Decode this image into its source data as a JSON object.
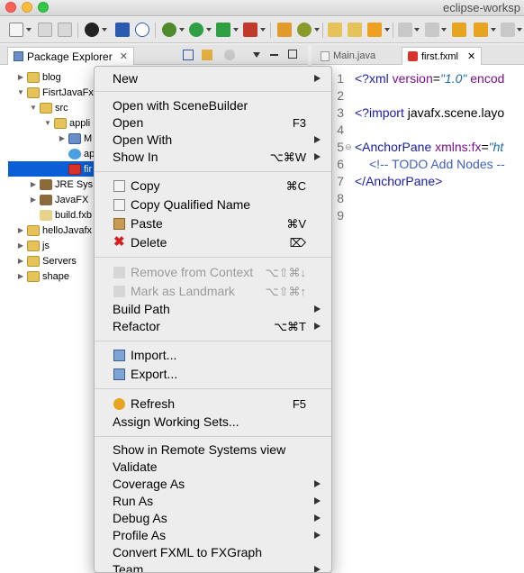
{
  "window": {
    "title": "eclipse-worksp"
  },
  "explorer": {
    "tab_label": "Package Explorer",
    "tree": [
      {
        "label": "blog",
        "icon": "project-icon",
        "twisty": "▶"
      },
      {
        "label": "FisrtJavaFx",
        "icon": "project-icon",
        "twisty": "▼"
      },
      {
        "label": "src",
        "icon": "folder-icon",
        "twisty": "▼"
      },
      {
        "label": "appli",
        "icon": "package-icon",
        "twisty": "▼"
      },
      {
        "label": "M",
        "icon": "java-file-icon",
        "twisty": "▶"
      },
      {
        "label": "ap",
        "icon": "css-file-icon",
        "twisty": ""
      },
      {
        "label": "fir",
        "icon": "fxml-file-icon",
        "twisty": ""
      },
      {
        "label": "JRE Sys",
        "icon": "library-icon",
        "twisty": "▶"
      },
      {
        "label": "JavaFX",
        "icon": "library-icon",
        "twisty": "▶"
      },
      {
        "label": "build.fxb",
        "icon": "file-icon",
        "twisty": ""
      },
      {
        "label": "helloJavafx",
        "icon": "project-icon",
        "twisty": "▶"
      },
      {
        "label": "js",
        "icon": "project-icon",
        "twisty": "▶"
      },
      {
        "label": "Servers",
        "icon": "folder-icon",
        "twisty": "▶"
      },
      {
        "label": "shape",
        "icon": "project-icon",
        "twisty": "▶"
      }
    ]
  },
  "editor": {
    "tabs": [
      {
        "label": "Main.java"
      },
      {
        "label": "first.fxml"
      }
    ],
    "line_numbers": [
      "1",
      "2",
      "3",
      "4",
      "5",
      "6",
      "7",
      "8",
      "9"
    ],
    "line1": {
      "a": "<?xml ",
      "b": "version",
      "c": "=",
      "d": "\"1.0\"",
      "e": " encod"
    },
    "line3": {
      "a": "<?import ",
      "b": "javafx.scene.layo"
    },
    "line5": {
      "a": "<AnchorPane ",
      "b": "xmlns:fx",
      "c": "=",
      "d": "\"ht"
    },
    "line6": {
      "a": "<!-- TODO Add Nodes --"
    },
    "line7": {
      "a": "</AnchorPane>"
    }
  },
  "menu": {
    "items": [
      {
        "label": "New",
        "shortcut": "",
        "submenu": true
      },
      {
        "label": "Open with SceneBuilder",
        "shortcut": "",
        "submenu": false
      },
      {
        "label": "Open",
        "shortcut": "F3",
        "submenu": false
      },
      {
        "label": "Open With",
        "shortcut": "",
        "submenu": true
      },
      {
        "label": "Show In",
        "shortcut": "⌥⌘W",
        "submenu": true
      },
      {
        "label": "Copy",
        "shortcut": "⌘C",
        "submenu": false,
        "icon": "copy-icon"
      },
      {
        "label": "Copy Qualified Name",
        "shortcut": "",
        "submenu": false,
        "icon": "copy-icon"
      },
      {
        "label": "Paste",
        "shortcut": "⌘V",
        "submenu": false,
        "icon": "paste-icon"
      },
      {
        "label": "Delete",
        "shortcut": "⌦",
        "submenu": false,
        "icon": "delete-icon"
      },
      {
        "label": "Remove from Context",
        "shortcut": "⌥⇧⌘↓",
        "submenu": false,
        "icon": "remove-context-icon",
        "disabled": true
      },
      {
        "label": "Mark as Landmark",
        "shortcut": "⌥⇧⌘↑",
        "submenu": false,
        "icon": "landmark-icon",
        "disabled": true
      },
      {
        "label": "Build Path",
        "shortcut": "",
        "submenu": true
      },
      {
        "label": "Refactor",
        "shortcut": "⌥⌘T",
        "submenu": true
      },
      {
        "label": "Import...",
        "shortcut": "",
        "submenu": false,
        "icon": "import-icon"
      },
      {
        "label": "Export...",
        "shortcut": "",
        "submenu": false,
        "icon": "export-icon"
      },
      {
        "label": "Refresh",
        "shortcut": "F5",
        "submenu": false,
        "icon": "refresh-icon"
      },
      {
        "label": "Assign Working Sets...",
        "shortcut": "",
        "submenu": false
      },
      {
        "label": "Show in Remote Systems view",
        "shortcut": "",
        "submenu": false
      },
      {
        "label": "Validate",
        "shortcut": "",
        "submenu": false
      },
      {
        "label": "Coverage As",
        "shortcut": "",
        "submenu": true
      },
      {
        "label": "Run As",
        "shortcut": "",
        "submenu": true
      },
      {
        "label": "Debug As",
        "shortcut": "",
        "submenu": true
      },
      {
        "label": "Profile As",
        "shortcut": "",
        "submenu": true
      },
      {
        "label": "Convert FXML to FXGraph",
        "shortcut": "",
        "submenu": false
      },
      {
        "label": "Team",
        "shortcut": "",
        "submenu": true
      }
    ]
  },
  "colors": {
    "selection": "#0b5fd6",
    "xml_tag": "#1a1aa6",
    "xml_attr": "#7a0f8c",
    "xml_value": "#1a6aa6",
    "xml_comment": "#3f5fbf",
    "close_light": "#fc605c",
    "min_light": "#fdbc40",
    "max_light": "#34c84a"
  }
}
